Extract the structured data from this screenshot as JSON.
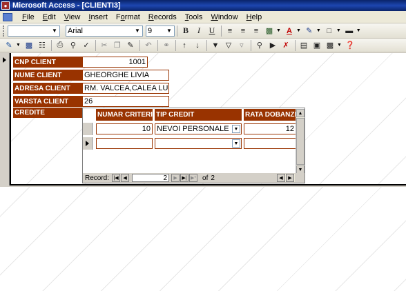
{
  "window": {
    "title": "Microsoft Access - [CLIENTI3]"
  },
  "menu": {
    "items": [
      {
        "label": "File",
        "ul": "F",
        "rest": "ile"
      },
      {
        "label": "Edit",
        "ul": "E",
        "rest": "dit"
      },
      {
        "label": "View",
        "ul": "V",
        "rest": "iew"
      },
      {
        "label": "Insert",
        "ul": "I",
        "rest": "nsert"
      },
      {
        "label": "Format",
        "ul": "o",
        "pre": "F",
        "rest": "rmat"
      },
      {
        "label": "Records",
        "ul": "R",
        "rest": "ecords"
      },
      {
        "label": "Tools",
        "ul": "T",
        "rest": "ools"
      },
      {
        "label": "Window",
        "ul": "W",
        "rest": "indow"
      },
      {
        "label": "Help",
        "ul": "H",
        "rest": "elp"
      }
    ]
  },
  "format_toolbar": {
    "object_value": "",
    "font": "Arial",
    "size": "9",
    "bold": "B",
    "italic": "I",
    "underline": "U"
  },
  "form": {
    "fields": [
      {
        "label": "CNP CLIENT",
        "value": "1001"
      },
      {
        "label": "NUME CLIENT",
        "value": "GHEORGHE LIVIA"
      },
      {
        "label": "ADRESA CLIENT",
        "value": "RM. VALCEA,CALEA LUI TR"
      },
      {
        "label": "VARSTA CLIENT",
        "value": "26"
      }
    ],
    "subform_label": "CREDITE"
  },
  "subform": {
    "columns": [
      "NUMAR CRITERIU",
      "TIP CREDIT",
      "RATA DOBANZII"
    ],
    "rows": [
      {
        "numar": "10",
        "tip": "NEVOI PERSONALE",
        "rata": "12"
      },
      {
        "numar": "",
        "tip": "",
        "rata": ""
      }
    ],
    "nav": {
      "label": "Record:",
      "current": "2",
      "of_label": "of",
      "total": "2"
    }
  },
  "colors": {
    "label_bg": "#993300",
    "label_fg": "#FFFFFF",
    "titlebar": "#0A246A"
  }
}
